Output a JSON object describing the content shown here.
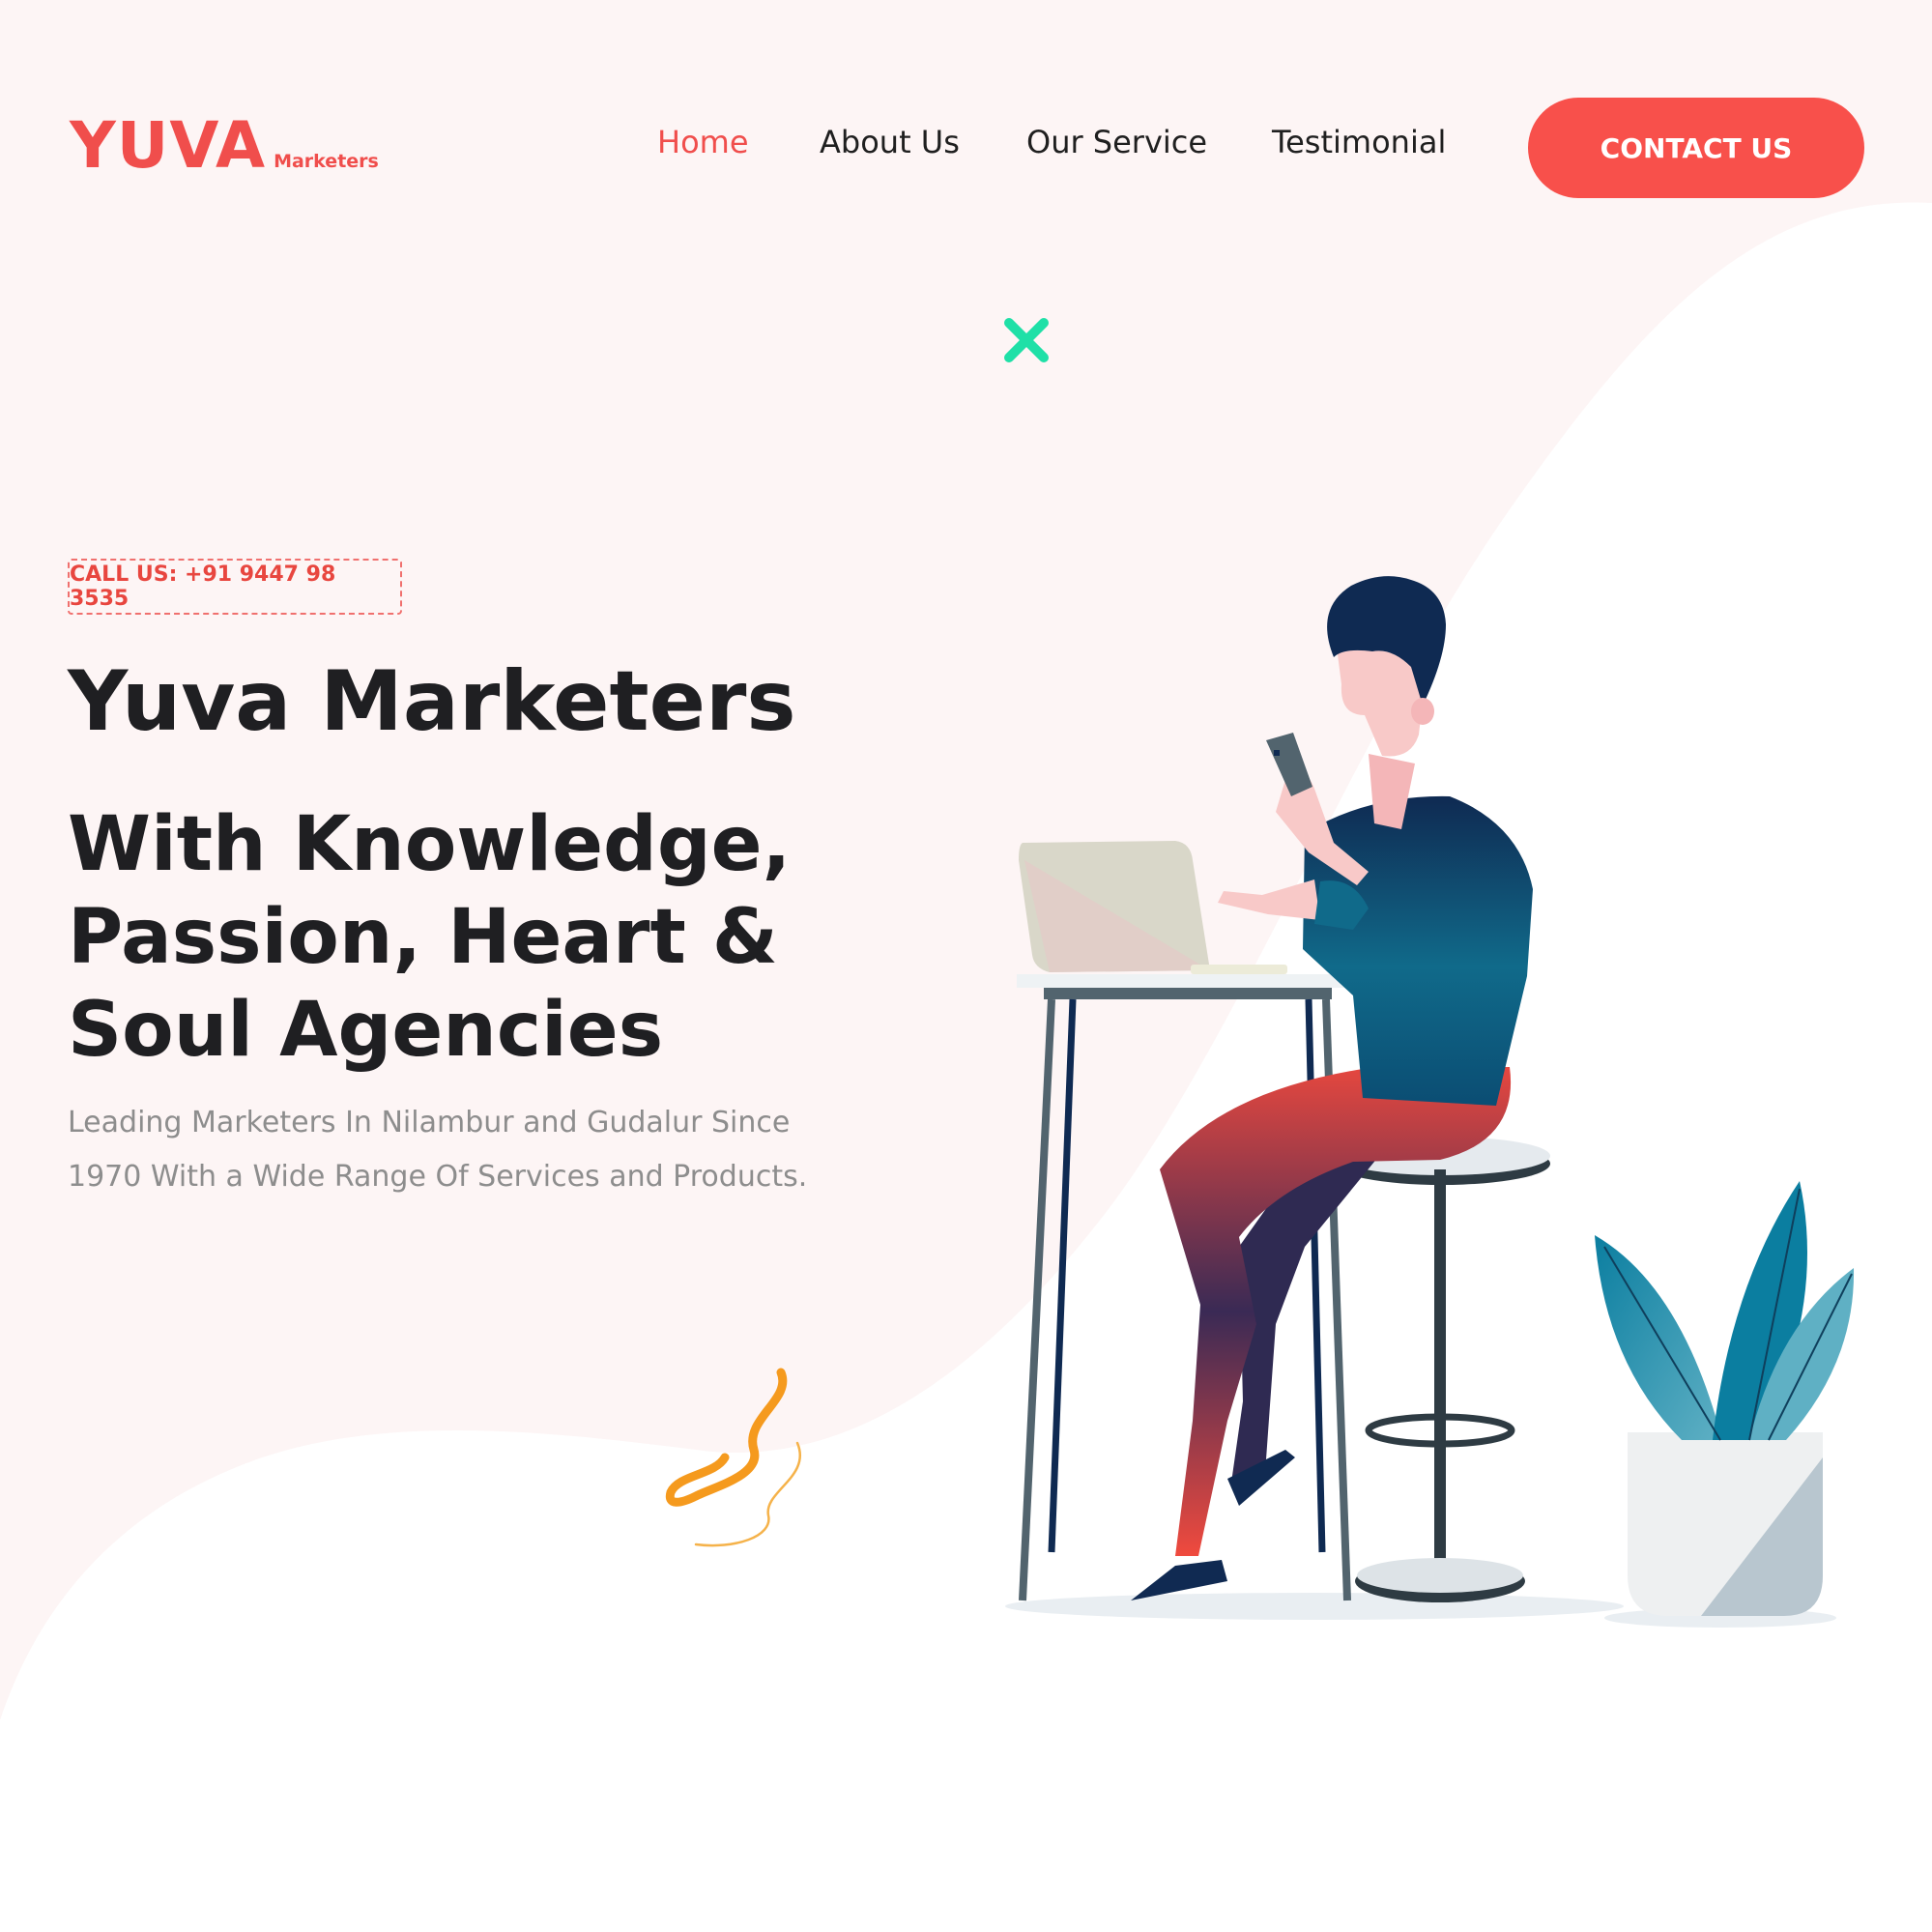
{
  "brand": {
    "name": "YUVA",
    "tagline": "Marketers",
    "color": "#f04e4c"
  },
  "nav": {
    "items": [
      {
        "label": "Home",
        "active": true
      },
      {
        "label": "About Us",
        "active": false
      },
      {
        "label": "Our Service",
        "active": false
      },
      {
        "label": "Testimonial",
        "active": false
      }
    ],
    "contact_label": "CONTACT US"
  },
  "hero": {
    "call_badge": "CALL US: +91 9447 98 3535",
    "title": "Yuva Marketers",
    "subtitle": "With Knowledge, Passion, Heart & Soul Agencies",
    "description": "Leading Marketers In Nilambur and Gudalur Since 1970 With a Wide Range Of Services and Products."
  },
  "icons": {
    "close": "close-icon",
    "squiggle": "squiggle-decoration-icon"
  },
  "colors": {
    "accent": "#f8504b",
    "background_blob": "#fdf5f5",
    "close_icon": "#1fe0a7",
    "heading": "#1f1f22",
    "body_text": "#8d8d8d"
  }
}
